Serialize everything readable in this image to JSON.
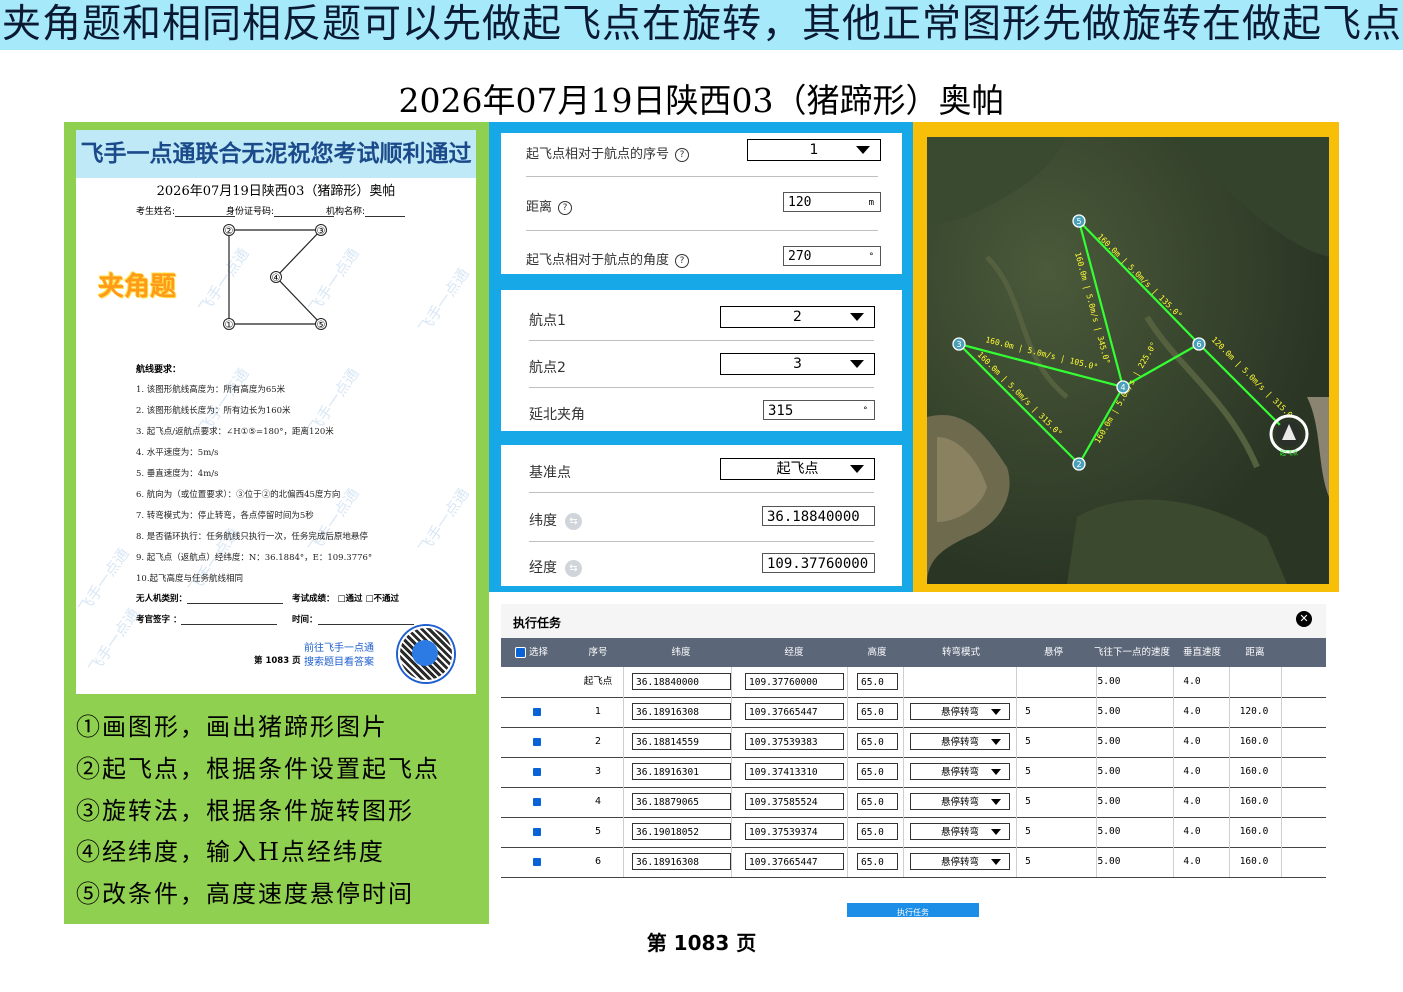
{
  "banner": "夹角题和相同相反题可以先做起飞点在旋转，其他正常图形先做旋转在做起飞点",
  "title": "2026年07月19日陕西03（猪蹄形）奥帕",
  "paper": {
    "header": "飞手一点通联合无泥祝您考试顺利通过",
    "title": "2026年07月19日陕西03（猪蹄形）奥帕",
    "info": [
      "考生姓名:",
      "身份证号码:",
      "机构名称:"
    ],
    "tag": "夹角题",
    "points": [
      "②",
      "③",
      "④",
      "①",
      "⑤"
    ],
    "req_head": "航线要求：",
    "requirements": [
      "1. 该图形航线高度为：所有高度为65米",
      "2. 该图形航线长度为：所有边长为160米",
      "3. 起飞点/返航点要求：∠H①⑤=180°，距离120米",
      "4. 水平速度为：5m/s",
      "5. 垂直速度为：4m/s",
      "6. 航向为（或位置要求）：③位于②的北偏西45度方向",
      "7. 转弯模式为：停止转弯，各点停留时间为5秒",
      "8. 是否循环执行：任务航线只执行一次，任务完成后原地悬停",
      "9. 起飞点（返航点）经纬度：N：36.1884°，E：109.3776°",
      "10.起飞高度与任务航线相同"
    ],
    "uav_type": "无人机类别：",
    "result": "考试成绩：",
    "pass": "□通过",
    "fail": "□不通过",
    "examiner": "考官签字 ：",
    "time": "时间：",
    "goto": "前往飞手一点通",
    "search": "搜索题目看答案",
    "page": "第 1083 页",
    "watermark": "飞手一点通"
  },
  "steps": [
    "①画图形，画出猪蹄形图片",
    "②起飞点，根据条件设置起飞点",
    "③旋转法，根据条件旋转图形",
    "④经纬度，输入H点经纬度",
    "⑤改条件，高度速度悬停时间"
  ],
  "takeoff": {
    "seq_label": "起飞点相对于航点的序号",
    "seq_value": "1",
    "dist_label": "距离",
    "dist_value": "120",
    "dist_unit": "m",
    "angle_label": "起飞点相对于航点的角度",
    "angle_value": "270",
    "angle_unit": "°"
  },
  "rotate": {
    "wp1_label": "航点1",
    "wp1_value": "2",
    "wp2_label": "航点2",
    "wp2_value": "3",
    "angle_label": "延北夹角",
    "angle_value": "315",
    "angle_unit": "°"
  },
  "base": {
    "ref_label": "基准点",
    "ref_value": "起飞点",
    "lat_label": "纬度",
    "lat_value": "36.18840000",
    "lon_label": "经度",
    "lon_value": "109.37760000"
  },
  "map": {
    "labels": [
      "160.0m | 5.0m/s | 135.0°",
      "160.0m | 5.0m/s | 345.0°",
      "160.0m | 5.0m/s | 105.0°",
      "160.0m | 5.0m/s | 315.0°",
      "160.0m | 5.0m/s | 225.0°",
      "120.0m | 5.0m/s | 315.0°"
    ],
    "wp_ids": [
      "5",
      "3",
      "6",
      "4",
      "2"
    ],
    "home_label": "起飞点"
  },
  "table": {
    "title": "执行任务",
    "headers": [
      "选择",
      "序号",
      "纬度",
      "经度",
      "高度",
      "转弯模式",
      "悬停",
      "飞往下一点的速度",
      "垂直速度",
      "距离"
    ],
    "rows": [
      {
        "seq": "起飞点",
        "lat": "36.18840000",
        "lon": "109.37760000",
        "alt": "65.0",
        "turn": "",
        "hover": "",
        "speed": "5.00",
        "vspeed": "4.0",
        "dist": ""
      },
      {
        "seq": "1",
        "lat": "36.18916308",
        "lon": "109.37665447",
        "alt": "65.0",
        "turn": "悬停转弯",
        "hover": "5",
        "speed": "5.00",
        "vspeed": "4.0",
        "dist": "120.0"
      },
      {
        "seq": "2",
        "lat": "36.18814559",
        "lon": "109.37539383",
        "alt": "65.0",
        "turn": "悬停转弯",
        "hover": "5",
        "speed": "5.00",
        "vspeed": "4.0",
        "dist": "160.0"
      },
      {
        "seq": "3",
        "lat": "36.18916301",
        "lon": "109.37413310",
        "alt": "65.0",
        "turn": "悬停转弯",
        "hover": "5",
        "speed": "5.00",
        "vspeed": "4.0",
        "dist": "160.0"
      },
      {
        "seq": "4",
        "lat": "36.18879065",
        "lon": "109.37585524",
        "alt": "65.0",
        "turn": "悬停转弯",
        "hover": "5",
        "speed": "5.00",
        "vspeed": "4.0",
        "dist": "160.0"
      },
      {
        "seq": "5",
        "lat": "36.19018052",
        "lon": "109.37539374",
        "alt": "65.0",
        "turn": "悬停转弯",
        "hover": "5",
        "speed": "5.00",
        "vspeed": "4.0",
        "dist": "160.0"
      },
      {
        "seq": "6",
        "lat": "36.18916308",
        "lon": "109.37665447",
        "alt": "65.0",
        "turn": "悬停转弯",
        "hover": "5",
        "speed": "5.00",
        "vspeed": "4.0",
        "dist": "160.0"
      }
    ],
    "exec_button": "执行任务"
  },
  "page_number": "第 1083 页",
  "colors": {
    "banner_bg": "#a6e9fb",
    "left_bg": "#8fd050",
    "mid_bg": "#17a8e8",
    "map_bg": "#f8bf08",
    "route": "#33ff33",
    "map_label": "#ffff33",
    "table_header": "#5b6678"
  }
}
